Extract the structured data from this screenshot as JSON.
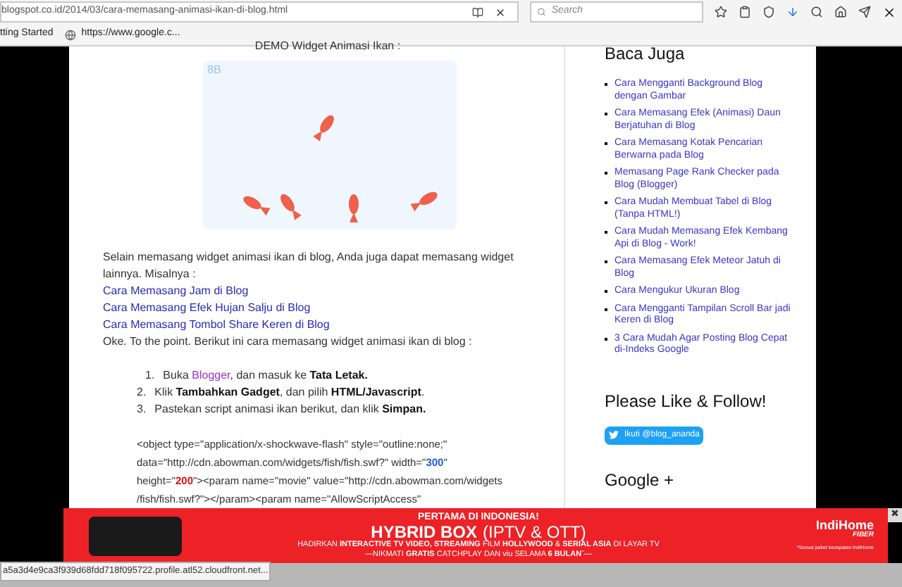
{
  "browser": {
    "url": "blogspot.co.id/2014/03/cara-memasang-animasi-ikan-di-blog.html",
    "search_placeholder": "Search",
    "bookmarks": [
      "tting Started",
      "https://www.google.c..."
    ],
    "status_url": "a5a3d4e9ca3f939d68fdd718f095722.profile.atl52.cloudfront.net..."
  },
  "article": {
    "caption": "DEMO Widget Animasi Ikan :",
    "demo_logo": "8B",
    "intro": "Selain memasang widget animasi ikan di blog, Anda juga dapat memasang widget lainnya. Misalnya :",
    "links": [
      "Cara Memasang Jam di Blog",
      "Cara Memasang Efek Hujan Salju di Blog",
      "Cara Memasang Tombol Share Keren di Blog"
    ],
    "lead": "Oke. To the point. Berikut ini cara memasang widget animasi ikan di blog :",
    "steps": [
      {
        "number": "1.",
        "parts": [
          {
            "kind": "text",
            "text": "Buka "
          },
          {
            "kind": "link",
            "text": "Blogger"
          },
          {
            "kind": "text",
            "text": ", dan masuk ke "
          },
          {
            "kind": "bold",
            "text": "Tata Letak."
          }
        ]
      },
      {
        "number": "2.",
        "parts": [
          {
            "kind": "text",
            "text": "Klik "
          },
          {
            "kind": "bold",
            "text": "Tambahkan Gadget"
          },
          {
            "kind": "text",
            "text": ", dan pilih "
          },
          {
            "kind": "bold",
            "text": "HTML/Javascript"
          },
          {
            "kind": "text",
            "text": "."
          }
        ]
      },
      {
        "number": "3.",
        "parts": [
          {
            "kind": "text",
            "text": "Pastekan script animasi ikan berikut, dan klik "
          },
          {
            "kind": "bold",
            "text": "Simpan."
          }
        ]
      }
    ],
    "code_lines": [
      [
        {
          "kind": "plain",
          "text": "<object type=\"application/x-shockwave-flash\" style=\"outline:none;\""
        }
      ],
      [
        {
          "kind": "plain",
          "text": "data=\"http://cdn.abowman.com/widgets/fish/fish.swf?\" width=\""
        },
        {
          "kind": "number",
          "text": "300",
          "color": "#1a5fd0"
        },
        {
          "kind": "plain",
          "text": "\""
        }
      ],
      [
        {
          "kind": "plain",
          "text": "height=\""
        },
        {
          "kind": "number",
          "text": "200",
          "color": "#e01010"
        },
        {
          "kind": "plain",
          "text": "\"><param name=\"movie\" value=\"http://cdn.abowman.com/widgets"
        }
      ],
      [
        {
          "kind": "plain",
          "text": "/fish/fish.swf?\"></param><param name=\"AllowScriptAccess\""
        }
      ]
    ]
  },
  "sidebar": {
    "title": "Baca Juga",
    "links": [
      "Cara Mengganti Background Blog dengan Gambar",
      "Cara Memasang Efek (Animasi) Daun Berjatuhan di Blog",
      "Cara Memasang Kotak Pencarian Berwarna pada Blog",
      "Memasang Page Rank Checker pada Blog (Blogger)",
      "Cara Mudah Membuat Tabel di Blog (Tanpa HTML!)",
      "Cara Mudah Memasang Efek Kembang Api di Blog - Work!",
      "Cara Memasang Efek Meteor Jatuh di Blog",
      "Cara Mengukur Ukuran Blog",
      "Cara Mengganti Tampilan Scroll Bar jadi Keren di Blog",
      "3 Cara Mudah Agar Posting Blog Cepat di-Indeks Google"
    ],
    "follow_title": "Please Like & Follow!",
    "follow_button": "Ikuti @blog_ananda",
    "google_title": "Google +"
  },
  "ad": {
    "headline": "PERTAMA DI INDONESIA!",
    "title": "HYBRID BOX",
    "title_suffix": "(IPTV & OTT)",
    "line1": "HADIRKAN **INTERACTIVE TV VIDEO, STREAMING** FILM **HOLLYWOOD** & **SERIAL ASIA** DI LAYAR TV",
    "line2": "—NIKMATI **GRATIS** CATCHPLAY DAN viu SELAMA **6 BULAN**ˆ—",
    "brand": "IndiHome",
    "brand_sub": "FIBER",
    "note": "*Sesuai paket kecepatan IndiHome",
    "close": "✖"
  }
}
